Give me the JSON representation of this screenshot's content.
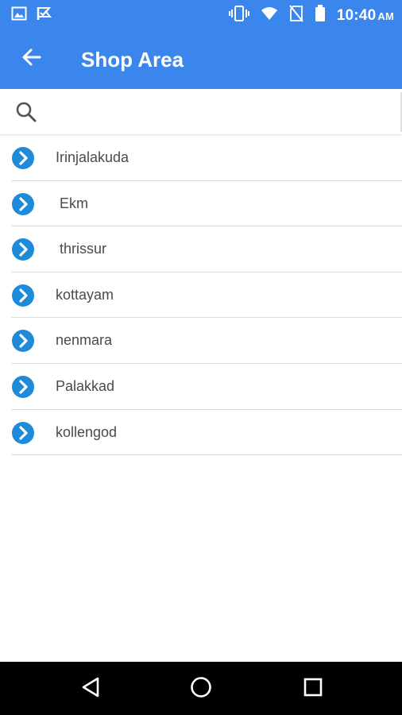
{
  "status_bar": {
    "time": "10:40",
    "ampm": "AM",
    "left_icons": [
      "image-icon",
      "check-flag-icon"
    ],
    "right_icons": [
      "vibrate-icon",
      "wifi-icon",
      "no-sim-icon",
      "battery-icon"
    ]
  },
  "app_bar": {
    "title": "Shop Area",
    "back_icon": "arrow-left-icon",
    "color": "#3b86ec"
  },
  "search": {
    "icon": "search-icon",
    "placeholder": "",
    "value": ""
  },
  "areas": [
    {
      "label": "Irinjalakuda"
    },
    {
      "label": " Ekm"
    },
    {
      "label": " thrissur"
    },
    {
      "label": "kottayam"
    },
    {
      "label": "nenmara"
    },
    {
      "label": "Palakkad"
    },
    {
      "label": "kollengod"
    }
  ],
  "accent_color": "#1e8ad8",
  "nav_bar": {
    "buttons": [
      "back-triangle-icon",
      "home-circle-icon",
      "recents-square-icon"
    ]
  }
}
